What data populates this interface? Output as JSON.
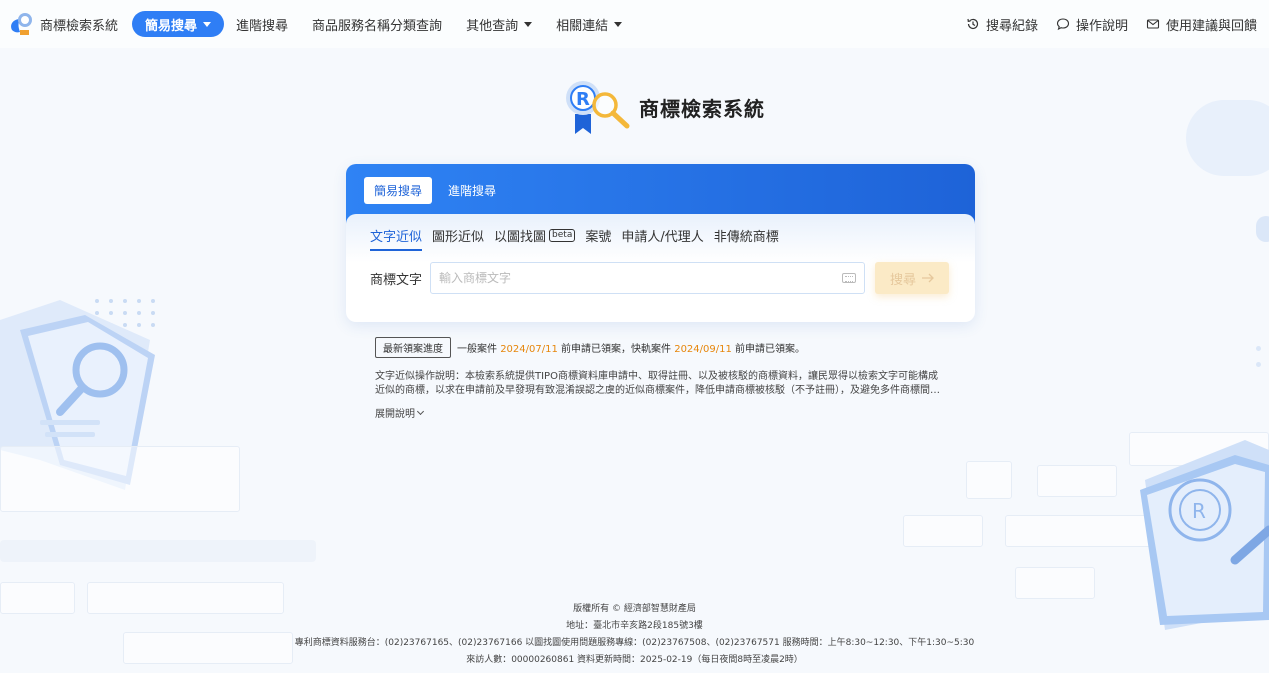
{
  "brand": {
    "name": "商標檢索系統"
  },
  "nav": {
    "items": [
      {
        "label": "簡易搜尋",
        "active": true,
        "dropdown": true
      },
      {
        "label": "進階搜尋",
        "active": false,
        "dropdown": false
      },
      {
        "label": "商品服務名稱分類查詢",
        "active": false,
        "dropdown": false
      },
      {
        "label": "其他查詢",
        "active": false,
        "dropdown": true
      },
      {
        "label": "相關連結",
        "active": false,
        "dropdown": true
      }
    ],
    "right": [
      {
        "label": "搜尋紀錄",
        "icon": "history-icon"
      },
      {
        "label": "操作說明",
        "icon": "chat-icon"
      },
      {
        "label": "使用建議與回饋",
        "icon": "mail-icon"
      }
    ]
  },
  "hero": {
    "title": "商標檢索系統"
  },
  "search": {
    "mode_tabs": [
      "簡易搜尋",
      "進階搜尋"
    ],
    "sub_tabs": [
      "文字近似",
      "圖形近似",
      "以圖找圖",
      "案號",
      "申請人/代理人",
      "非傳統商標"
    ],
    "beta": "beta",
    "field_label": "商標文字",
    "placeholder": "輸入商標文字",
    "button_label": "搜尋"
  },
  "progress": {
    "tag": "最新領案進度",
    "text1": "一般案件",
    "date1": "2024/07/11",
    "text2": "前申請已領案，快軌案件",
    "date2": "2024/09/11",
    "text3": "前申請已領案。"
  },
  "description": {
    "text": "文字近似操作說明：本檢索系統提供TIPO商標資料庫申請中、取得註冊、以及被核駁的商標資料，讓民眾得以檢索文字可能構成近似的商標，以求在申請前及早發現有致混淆誤認之虞的近似商標案件，降低申請商標被核駁（不予註冊），及避免多件商標間…",
    "expand_label": "展開說明"
  },
  "footer": {
    "line1": "版權所有 © 經濟部智慧財產局",
    "line2": "地址：臺北市辛亥路2段185號3樓",
    "line3": "專利商標資料服務台：(02)23767165、(02)23767166 以圖找圖使用問題服務專線：(02)23767508、(02)23767571 服務時間：上午8:30~12:30、下午1:30~5:30",
    "line4": "來訪人數：00000260861 資料更新時間：2025-02-19（每日夜間8時至凌晨2時）"
  },
  "colors": {
    "primary": "#2f7ef5",
    "header_gradient_end": "#1e63d8",
    "accent_orange": "#e6870d",
    "button_disabled": "#fbeac6"
  }
}
